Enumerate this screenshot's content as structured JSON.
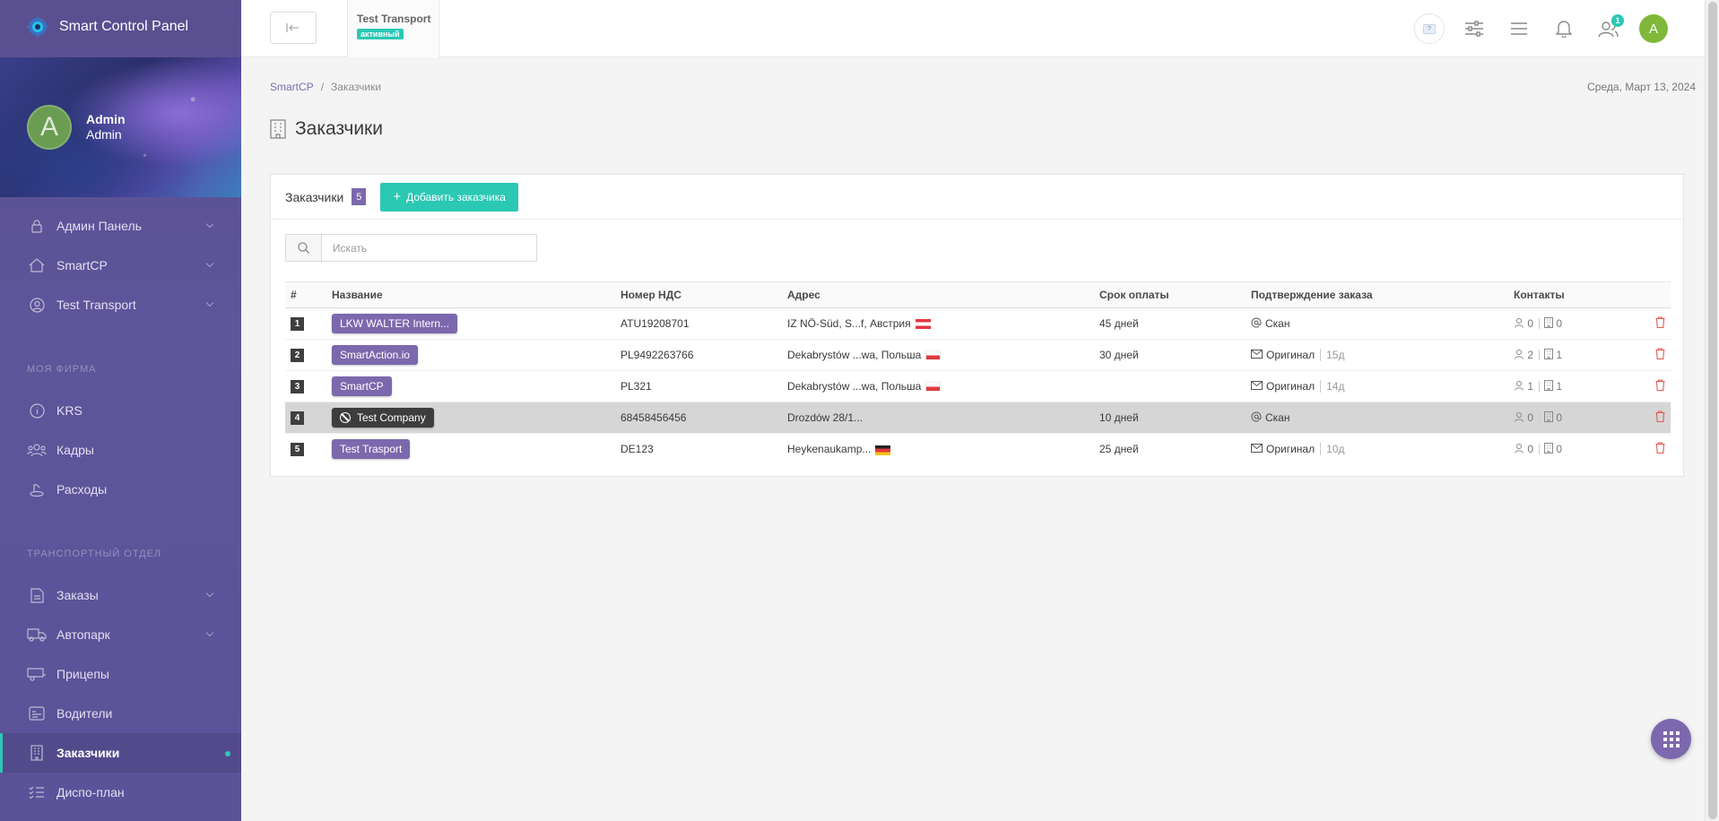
{
  "app": {
    "title": "Smart Control Panel"
  },
  "profile": {
    "avatar_letter": "A",
    "name": "Admin",
    "role": "Admin"
  },
  "nav": {
    "items_main": [
      {
        "label": "Админ Панель",
        "icon": "lock-icon"
      },
      {
        "label": "SmartCP",
        "icon": "home-icon"
      },
      {
        "label": "Test Transport",
        "icon": "user-circle-icon"
      }
    ],
    "section_firm": "МОЯ ФИРМА",
    "items_firm": [
      {
        "label": "KRS",
        "icon": "info-icon"
      },
      {
        "label": "Кадры",
        "icon": "users-icon"
      },
      {
        "label": "Расходы",
        "icon": "coins-icon"
      }
    ],
    "section_transport": "ТРАНСПОРТНЫЙ ОТДЕЛ",
    "items_transport": [
      {
        "label": "Заказы",
        "icon": "document-icon"
      },
      {
        "label": "Автопарк",
        "icon": "truck-icon"
      },
      {
        "label": "Прицепы",
        "icon": "trailer-icon"
      },
      {
        "label": "Водители",
        "icon": "driver-icon"
      },
      {
        "label": "Заказчики",
        "icon": "building-icon"
      },
      {
        "label": "Диспо-план",
        "icon": "list-icon"
      }
    ]
  },
  "topbar": {
    "company_name": "Test Transport",
    "company_status": "активный",
    "notifications_badge": "1",
    "user_avatar_letter": "A"
  },
  "breadcrumb": {
    "root": "SmartCP",
    "current": "Заказчики"
  },
  "date": "Среда, Март 13, 2024",
  "page": {
    "title": "Заказчики"
  },
  "card": {
    "label": "Заказчики",
    "count": "5",
    "add_button": "Добавить заказчика"
  },
  "search": {
    "placeholder": "Искать"
  },
  "table": {
    "columns": [
      "#",
      "Название",
      "Номер НДС",
      "Адрес",
      "Срок оплаты",
      "Подтверждение заказа",
      "Контакты"
    ],
    "rows": [
      {
        "num": "1",
        "name": "LKW WALTER Intern...",
        "vat": "ATU19208701",
        "address": "IZ NÖ-Süd, S...f, Австрия",
        "flag": "at",
        "term": "45 дней",
        "conf_icon": "at-icon",
        "conf": "Скан",
        "conf_days": "",
        "persons": "0",
        "buildings": "0"
      },
      {
        "num": "2",
        "name": "SmartAction.io",
        "vat": "PL9492263766",
        "address": "Dekabrystów ...wa, Польша",
        "flag": "pl",
        "term": "30 дней",
        "conf_icon": "mail-icon",
        "conf": "Оригинал",
        "conf_days": "15д",
        "persons": "2",
        "buildings": "1"
      },
      {
        "num": "3",
        "name": "SmartCP",
        "vat": "PL321",
        "address": "Dekabrystów ...wa, Польша",
        "flag": "pl",
        "term": "",
        "conf_icon": "mail-icon",
        "conf": "Оригинал",
        "conf_days": "14д",
        "persons": "1",
        "buildings": "1"
      },
      {
        "num": "4",
        "name": "Test Company",
        "vat": "68458456456",
        "address": "Drozdów 28/1...",
        "flag": "",
        "term": "10 дней",
        "conf_icon": "at-icon",
        "conf": "Скан",
        "conf_days": "",
        "persons": "0",
        "buildings": "0"
      },
      {
        "num": "5",
        "name": "Test Trasport",
        "vat": "DE123",
        "address": "Heykenaukamp...",
        "flag": "de",
        "term": "25 дней",
        "conf_icon": "mail-icon",
        "conf": "Оригинал",
        "conf_days": "10д",
        "persons": "0",
        "buildings": "0"
      }
    ]
  },
  "colors": {
    "accent": "#2bc8b4",
    "brand": "#7c68ad",
    "sidebar": "#5b5299",
    "danger": "#e05a4f"
  }
}
